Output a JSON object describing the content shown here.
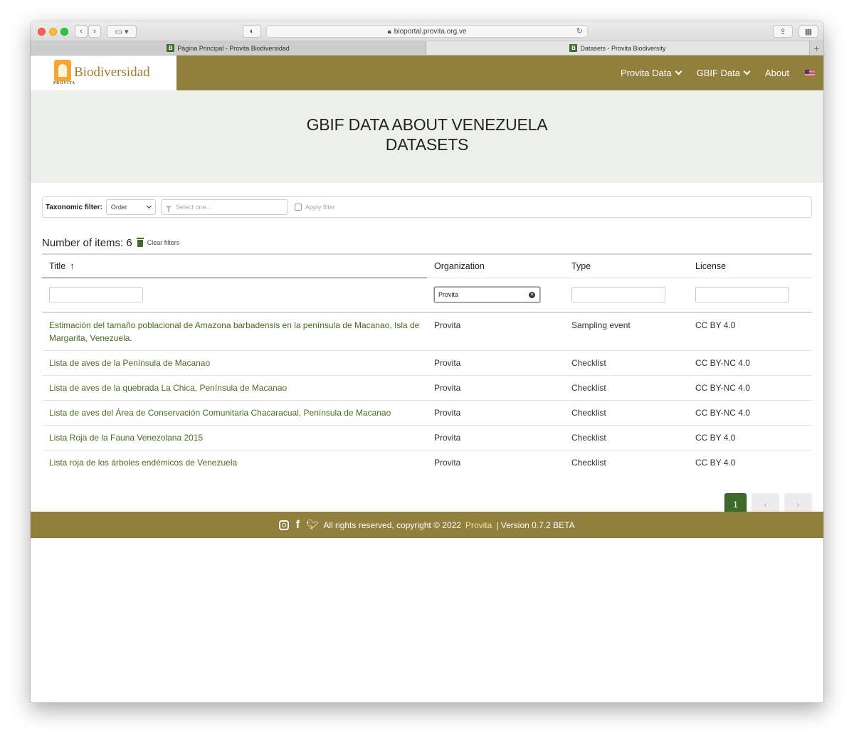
{
  "browser": {
    "url": "bioportal.provita.org.ve",
    "tabs": [
      {
        "favicon": "B",
        "label": "Página Principal - Provita Biodiversidad"
      },
      {
        "favicon": "B",
        "label": "Datasets - Provita Biodiversity"
      }
    ],
    "new_tab_label": "+"
  },
  "nav": {
    "brand": "Biodiversidad",
    "brand_sub": "PROVITA",
    "items": [
      "Provita Data",
      "GBIF Data",
      "About"
    ]
  },
  "hero": {
    "line1": "GBIF DATA ABOUT VENEZUELA",
    "line2": "DATASETS"
  },
  "filter": {
    "label": "Taxonomic filter:",
    "rank": "Order",
    "placeholder": "Select one...",
    "apply_label": "Apply filter"
  },
  "summary": {
    "count_text": "Number of items: 6",
    "clear_label": "Clear filters"
  },
  "table": {
    "headers": [
      "Title",
      "Organization",
      "Type",
      "License"
    ],
    "org_filter_value": "Provita",
    "rows": [
      {
        "title": "Estimación del tamaño poblacional de Amazona barbadensis en la península de Macanao, Isla de Margarita, Venezuela.",
        "org": "Provita",
        "type": "Sampling event",
        "license": "CC BY 4.0"
      },
      {
        "title": "Lista de aves de la Península de Macanao",
        "org": "Provita",
        "type": "Checklist",
        "license": "CC BY-NC 4.0"
      },
      {
        "title": "Lista de aves de la quebrada La Chica, Península de Macanao",
        "org": "Provita",
        "type": "Checklist",
        "license": "CC BY-NC 4.0"
      },
      {
        "title": "Lista de aves del Área de Conservación Comunitaria Chacaracual, Península de Macanao",
        "org": "Provita",
        "type": "Checklist",
        "license": "CC BY-NC 4.0"
      },
      {
        "title": "Lista Roja de la Fauna Venezolana 2015",
        "org": "Provita",
        "type": "Checklist",
        "license": "CC BY 4.0"
      },
      {
        "title": "Lista roja de los árboles endémicos de Venezuela",
        "org": "Provita",
        "type": "Checklist",
        "license": "CC BY 4.0"
      }
    ]
  },
  "pagination": {
    "current": "1",
    "prev": "‹",
    "next": "›"
  },
  "footer": {
    "text": "All rights reserved, copyright © 2022",
    "link": "Provita",
    "version": "| Version 0.7.2 BETA"
  },
  "colors": {
    "navbar": "#917f3e",
    "hero_bg": "#edf0ea",
    "link_green": "#4d6a20",
    "accent_green": "#3e6b2a"
  }
}
